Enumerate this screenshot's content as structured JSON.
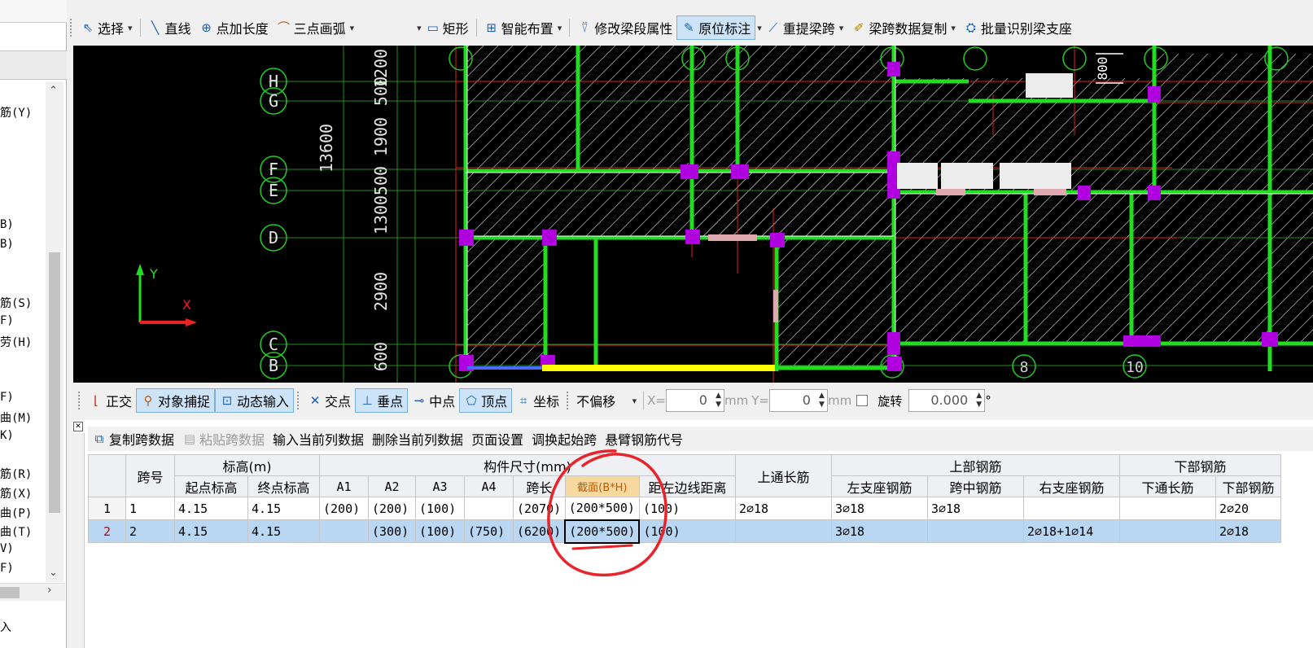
{
  "toolbar_top": {
    "select": "选择",
    "line": "直线",
    "point_length": "点加长度",
    "arc": "三点画弧",
    "rect": "矩形",
    "smart_layout": "智能布置",
    "modify_props": "修改梁段属性",
    "origin_mark": "原位标注",
    "relift_span": "重提梁跨",
    "copy_span_data": "梁跨数据复制",
    "batch_identify": "批量识别梁支座"
  },
  "left_panel": {
    "items": [
      "筋(Y)",
      "B)",
      "B)",
      "筋(S)",
      "F)",
      "劳(H)",
      "F)",
      "曲(M)",
      "K)",
      "筋(R)",
      "筋(X)",
      "曲(P)",
      "曲(T)",
      "V)",
      "F)",
      "入"
    ]
  },
  "cad": {
    "axis_letters": [
      "H",
      "G",
      "F",
      "E",
      "D",
      "C",
      "B"
    ],
    "vert_dims": [
      "1200",
      "500",
      "1900",
      "500",
      "1300",
      "2900",
      "600"
    ],
    "total_dim": "13600",
    "bubble_8": "8",
    "bubble_10": "10",
    "dim_800": "800",
    "ucs_y": "Y",
    "ucs_x": "X"
  },
  "toolbar_snap": {
    "ortho": "正交",
    "object_snap": "对象捕捉",
    "dynamic_input": "动态输入",
    "intersection": "交点",
    "perpendicular": "垂点",
    "midpoint": "中点",
    "vertex": "顶点",
    "coord": "坐标",
    "offset_value": "不偏移",
    "x_label": "X=",
    "x_value": "0",
    "x_unit": "mm",
    "y_label": "Y=",
    "y_value": "0",
    "y_unit": "mm",
    "rotate": "旋转",
    "rotate_value": "0.000",
    "deg": "°"
  },
  "toolbar_table": {
    "copy_span": "复制跨数据",
    "paste_span": "粘贴跨数据",
    "input_column": "输入当前列数据",
    "delete_column": "删除当前列数据",
    "page_setup": "页面设置",
    "swap_start": "调换起始跨",
    "cantilever_code": "悬臂钢筋代号"
  },
  "table": {
    "headers": {
      "span_no": "跨号",
      "elevation": "标高(m)",
      "start_elev": "起点标高",
      "end_elev": "终点标高",
      "member_size": "构件尺寸(mm)",
      "a1": "A1",
      "a2": "A2",
      "a3": "A3",
      "a4": "A4",
      "span_len": "跨长",
      "section": "截面(B*H)",
      "dist_left": "距左边线距离",
      "top_through": "上通长筋",
      "top_rebar": "上部钢筋",
      "left_support": "左支座钢筋",
      "mid_span": "跨中钢筋",
      "right_support": "右支座钢筋",
      "bottom_rebar": "下部钢筋",
      "bottom_through": "下通长筋",
      "bottom_partial": "下部钢筋"
    },
    "rows": [
      {
        "rn": "1",
        "span": "1",
        "start": "4.15",
        "end": "4.15",
        "a1": "(200)",
        "a2": "(200)",
        "a3": "(100)",
        "a4": "",
        "len": "(2070)",
        "section": "(200*500)",
        "dist": "(100)",
        "top_through": "2⌀18",
        "left": "3⌀18",
        "mid": "3⌀18",
        "right": "",
        "bot_through": "",
        "bot": "2⌀20"
      },
      {
        "rn": "2",
        "span": "2",
        "start": "4.15",
        "end": "4.15",
        "a1": "",
        "a2": "(300)",
        "a3": "(100)",
        "a4": "(750)",
        "len": "(6200)",
        "section": "(200*500)",
        "dist": "(100)",
        "top_through": "",
        "left": "3⌀18",
        "mid": "",
        "right": "2⌀18+1⌀14",
        "bot_through": "",
        "bot": "2⌀18"
      }
    ]
  },
  "colors": {
    "canvas_bg": "#000000",
    "beam_green": "#22dd22",
    "axis_green": "#1f8f1f",
    "grid_red": "#e02020",
    "column_purple": "#b000e0",
    "selected_beam": "#ffff00",
    "annotation_red": "#e8232a",
    "row_selected": "#b9d7f3"
  }
}
